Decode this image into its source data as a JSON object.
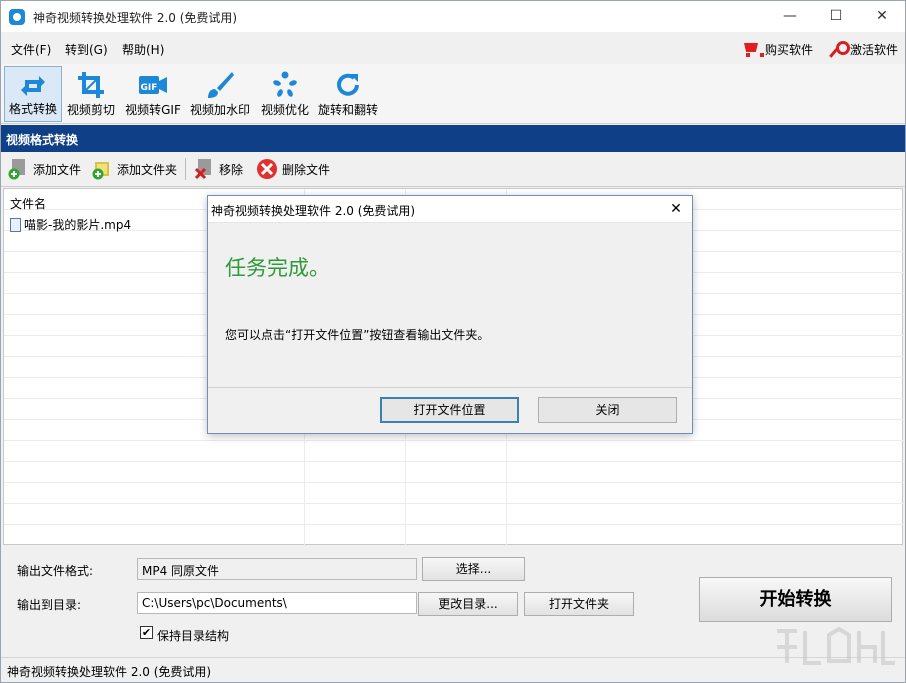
{
  "window": {
    "title": "神奇视频转换处理软件 2.0 (免费试用)",
    "controls": {
      "minimize": "—",
      "maximize": "☐",
      "close": "✕"
    }
  },
  "menu": {
    "items": [
      "文件(F)",
      "转到(G)",
      "帮助(H)"
    ],
    "buy_label": "购买软件",
    "activate_label": "激活软件"
  },
  "toolbar": {
    "tools": [
      {
        "label": "格式转换",
        "icon": "convert-icon",
        "active": true
      },
      {
        "label": "视频剪切",
        "icon": "crop-icon"
      },
      {
        "label": "视频转GIF",
        "icon": "gif-icon",
        "icon_text": "GIF"
      },
      {
        "label": "视频加水印",
        "icon": "brush-icon"
      },
      {
        "label": "视频优化",
        "icon": "optimize-icon"
      },
      {
        "label": "旋转和翻转",
        "icon": "rotate-icon"
      }
    ]
  },
  "section": {
    "title": "视频格式转换"
  },
  "file_actions": {
    "add_file": "添加文件",
    "add_folder": "添加文件夹",
    "remove": "移除",
    "delete_file": "删除文件"
  },
  "file_list": {
    "column_header": "文件名",
    "files": [
      "喵影-我的影片.mp4"
    ]
  },
  "output": {
    "format_label": "输出文件格式:",
    "format_value": "MP4 同原文件",
    "choose_button": "选择...",
    "dir_label": "输出到目录:",
    "dir_value": "C:\\Users\\pc\\Documents\\",
    "change_dir_button": "更改目录...",
    "open_folder_button": "打开文件夹",
    "keep_structure_label": "保持目录结构",
    "keep_structure_checked": true,
    "start_button": "开始转换"
  },
  "status": {
    "text": "神奇视频转换处理软件 2.0 (免费试用)"
  },
  "dialog": {
    "title": "神奇视频转换处理软件 2.0 (免费试用)",
    "heading": "任务完成。",
    "message": "您可以点击“打开文件位置”按钮查看输出文件夹。",
    "open_location_button": "打开文件位置",
    "close_button": "关闭"
  },
  "colors": {
    "section_header_bg": "#0f3f86",
    "heading_green": "#2f9a3a",
    "accent_blue": "#1e88d8"
  }
}
